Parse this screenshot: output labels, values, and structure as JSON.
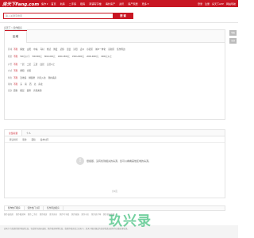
{
  "topnav": {
    "logo": "房天下Fang.com",
    "city": "焦作 ▾",
    "links": [
      "首页",
      "新房",
      "二手房",
      "租房",
      "商铺写字楼",
      "海外房产",
      "资讯",
      "房产家居",
      "更多 ▾"
    ],
    "right": [
      "登录",
      "注册",
      "房天下APP",
      "网站导航"
    ]
  },
  "search": {
    "placeholder": "输入关键字搜索",
    "button": "搜 索"
  },
  "breadcrumb": "房天下 > 焦作租房",
  "filter": {
    "tab": "区域",
    "rows": [
      {
        "label": "区域",
        "options": [
          "不限",
          "解放",
          "山阳",
          "中站",
          "马村",
          "修武",
          "博爱",
          "武陟",
          "温县",
          "沁阳",
          "孟州",
          "示范区",
          "城乡一体化",
          "高新区",
          "焦作周边"
        ]
      },
      {
        "label": "租金",
        "options": [
          "不限",
          "500元以下",
          "500-800元",
          "800-1000元",
          "1000-1500元",
          "1500-2000元",
          "2000-3000元",
          "3000元以上"
        ]
      },
      {
        "label": "户型",
        "options": [
          "不限",
          "一居",
          "二居",
          "三居",
          "四居",
          "五居以上"
        ]
      },
      {
        "label": "方式",
        "options": [
          "不限",
          "整租",
          "合租"
        ]
      },
      {
        "label": "特色",
        "options": [
          "不限",
          "近地铁",
          "精装修",
          "拎包入住",
          "随时看房"
        ]
      },
      {
        "label": "朝向",
        "options": [
          "不限",
          "东",
          "南",
          "西",
          "北",
          "南北"
        ]
      },
      {
        "label": "更多",
        "options": [
          "面积",
          "楼层",
          "装修",
          "房源来源"
        ]
      }
    ],
    "side_buttons": [
      "地图",
      "顶部"
    ]
  },
  "results": {
    "tabs": [
      "全部房源",
      "个人"
    ],
    "sort": [
      "默认排序",
      "租金",
      "面积",
      "发布时间"
    ],
    "empty_text": "很抱歉，没有找到相关的房源，您可以看看其他区域的房源。",
    "pager": "共0页"
  },
  "bottom": {
    "tabs": [
      "焦作热门租房",
      "焦作热门小区",
      "焦作周边租房"
    ],
    "links": [
      "焦作出租房",
      "焦作租房网",
      "焦作二手房",
      "焦作新房",
      "焦作房价",
      "焦作写字楼",
      "焦作商铺",
      "焦作小区",
      "焦作房产网",
      "焦作房屋出租"
    ]
  },
  "footer": {
    "text": "房天下为您提供焦作租房信息，包括焦作房屋出租、焦作租房网等信息，找焦作租房就上房天下。房天下租房频道为您提供真实的焦作出租房源信息。"
  },
  "watermark": "玖兴录",
  "colors": {
    "brand": "#c81623",
    "watermark": "#00aa50"
  }
}
